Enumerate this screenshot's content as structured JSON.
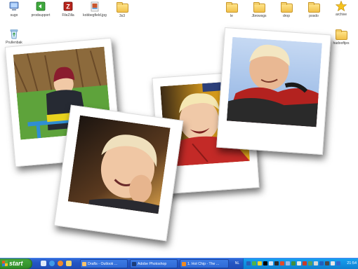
{
  "desktop": {
    "icons_left": [
      {
        "label": "sugo",
        "icon": "computer-icon"
      },
      {
        "label": "prodsupport",
        "icon": "app-icon"
      },
      {
        "label": "FileZilla",
        "icon": "filezilla-icon"
      },
      {
        "label": "kobbegfield.jpg",
        "icon": "image-file-icon"
      },
      {
        "label": "3x3",
        "icon": "folder-icon"
      },
      {
        "label": "Prullenbak",
        "icon": "recycle-bin-icon"
      }
    ],
    "icons_right": [
      {
        "label": "le",
        "icon": "folder-icon"
      },
      {
        "label": "Jbrowsgs",
        "icon": "folder-icon"
      },
      {
        "label": "drop",
        "icon": "folder-icon"
      },
      {
        "label": "posdo",
        "icon": "folder-icon"
      },
      {
        "label": "archive",
        "icon": "star-icon"
      },
      {
        "label": "hadooftjes",
        "icon": "folder-icon"
      }
    ]
  },
  "photos": [
    {
      "name": "photo-child-on-rocker",
      "subject": "child in red hat on playground rocker"
    },
    {
      "name": "photo-child-hand-on-face",
      "subject": "smiling child with hand on face"
    },
    {
      "name": "photo-child-laughing",
      "subject": "laughing child in red jacket"
    },
    {
      "name": "photo-child-outdoor",
      "subject": "smiling child outdoors in red jacket"
    }
  ],
  "taskbar": {
    "start_label": "start",
    "buttons": [
      {
        "label": "Drafts - Outlook ...",
        "icon_color": "#f6c36a"
      },
      {
        "label": "Adobe Photoshop",
        "icon_color": "#1c3d78"
      },
      {
        "label": "1. Hot Chip - The ...",
        "icon_color": "#f08a20"
      }
    ],
    "language": "NL",
    "clock": "21:54"
  },
  "colors": {
    "taskbar_blue": "#2456c4",
    "start_green": "#3a9a31",
    "tray_blue": "#1290e1"
  }
}
